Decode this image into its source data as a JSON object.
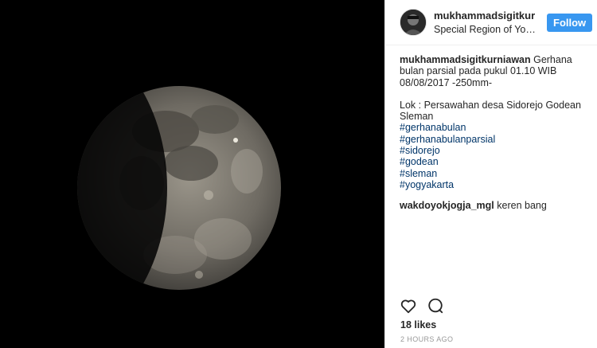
{
  "header": {
    "username": "mukhammadsigitkurniawan",
    "location": "Special Region of Yogyakarta",
    "follow_label": "Follow"
  },
  "caption": {
    "username": "mukhammadsigitkurniawan",
    "line1": " Gerhana bulan parsial pada pukul 01.10 WIB 08/08/2017 -250mm-",
    "line2": "Lok : Persawahan desa Sidorejo Godean Sleman",
    "hashtags": [
      "#gerhanabulan",
      "#gerhanabulanparsial",
      "#sidorejo",
      "#godean",
      "#sleman",
      "#yogyakarta"
    ]
  },
  "comment": {
    "username": "wakdoyokjogja_mgl",
    "text": " keren bang"
  },
  "likes": "18 likes",
  "timestamp": "2 HOURS AGO",
  "icons": {
    "like": "heart-icon",
    "comment": "comment-icon"
  },
  "colors": {
    "follow_button": "#3897f0",
    "hashtag": "#003569",
    "timestamp": "#999999"
  }
}
